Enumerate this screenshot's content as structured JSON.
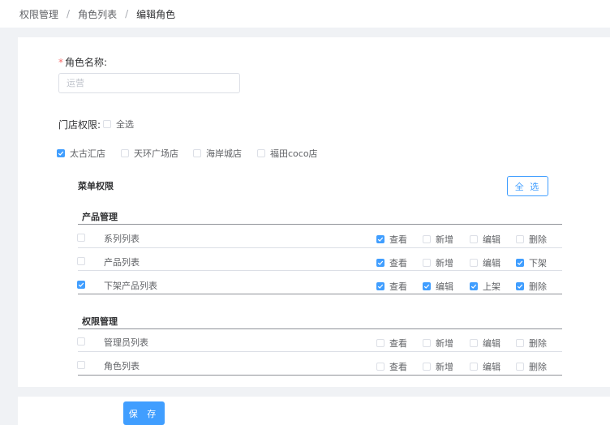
{
  "breadcrumb": {
    "items": [
      "权限管理",
      "角色列表",
      "编辑角色"
    ],
    "separator": "/"
  },
  "form": {
    "role_name_required_mark": "*",
    "role_name_label": "角色名称:",
    "role_name_placeholder": "运营",
    "store_perm_label": "门店权限:",
    "select_all_label": "全选",
    "select_all_checked": false,
    "stores": [
      {
        "label": "太古汇店",
        "checked": true
      },
      {
        "label": "天环广场店",
        "checked": false
      },
      {
        "label": "海岸城店",
        "checked": false
      },
      {
        "label": "福田coco店",
        "checked": false
      }
    ]
  },
  "menu": {
    "title": "菜单权限",
    "select_all_button": "全 选",
    "groups": [
      {
        "title": "产品管理",
        "rows": [
          {
            "name": "系列列表",
            "checked": false,
            "perms": [
              {
                "label": "查看",
                "checked": true
              },
              {
                "label": "新增",
                "checked": false
              },
              {
                "label": "编辑",
                "checked": false
              },
              {
                "label": "删除",
                "checked": false
              }
            ]
          },
          {
            "name": "产品列表",
            "checked": false,
            "perms": [
              {
                "label": "查看",
                "checked": true
              },
              {
                "label": "新增",
                "checked": false
              },
              {
                "label": "编辑",
                "checked": false
              },
              {
                "label": "下架",
                "checked": true
              }
            ]
          },
          {
            "name": "下架产品列表",
            "checked": true,
            "perms": [
              {
                "label": "查看",
                "checked": true
              },
              {
                "label": "编辑",
                "checked": true
              },
              {
                "label": "上架",
                "checked": true
              },
              {
                "label": "删除",
                "checked": true
              }
            ]
          }
        ]
      },
      {
        "title": "权限管理",
        "rows": [
          {
            "name": "管理员列表",
            "checked": false,
            "perms": [
              {
                "label": "查看",
                "checked": false
              },
              {
                "label": "新增",
                "checked": false
              },
              {
                "label": "编辑",
                "checked": false
              },
              {
                "label": "删除",
                "checked": false
              }
            ]
          },
          {
            "name": "角色列表",
            "checked": false,
            "perms": [
              {
                "label": "查看",
                "checked": false
              },
              {
                "label": "新增",
                "checked": false
              },
              {
                "label": "编辑",
                "checked": false
              },
              {
                "label": "删除",
                "checked": false
              }
            ]
          }
        ]
      }
    ]
  },
  "actions": {
    "save_label": "保 存"
  },
  "colors": {
    "primary": "#409eff",
    "required": "#f56c6c",
    "background": "#f0f2f5"
  }
}
